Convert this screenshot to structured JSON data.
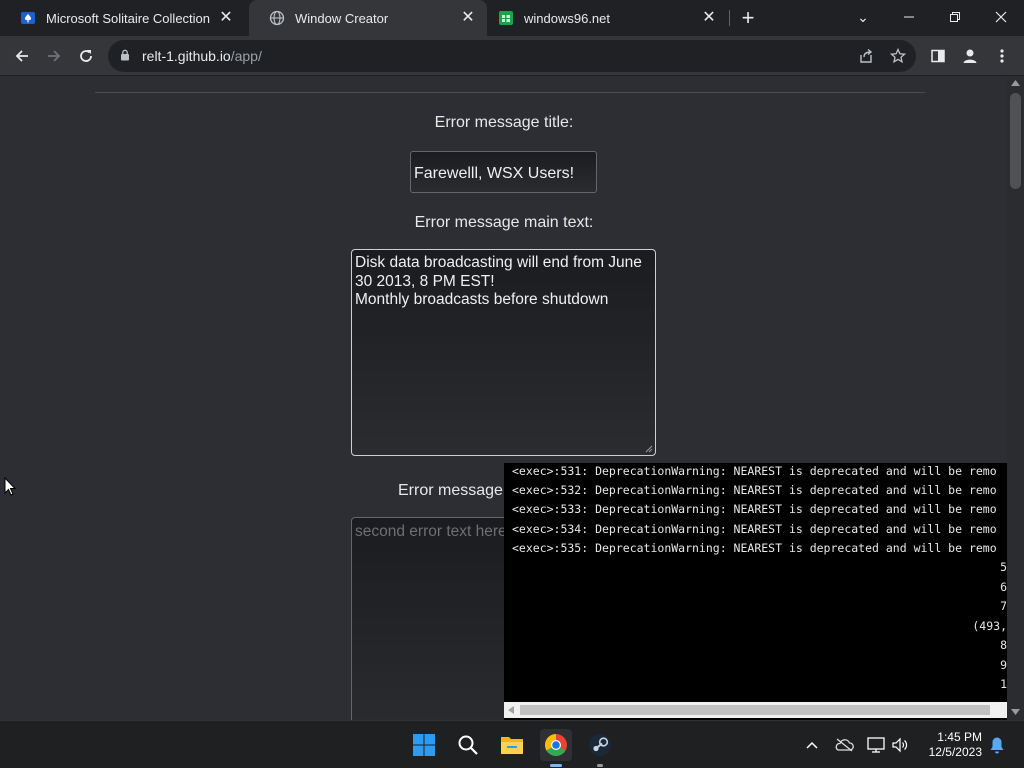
{
  "tabs": [
    {
      "title": "Microsoft Solitaire Collection",
      "active": false
    },
    {
      "title": "Window Creator",
      "active": true
    },
    {
      "title": "windows96.net",
      "active": false
    }
  ],
  "address": {
    "host": "relt-1.github.io",
    "path": "/app/"
  },
  "form": {
    "title_label": "Error message title:",
    "title_value": "Farewelll, WSX Users!",
    "main_label": "Error message main text:",
    "main_line1": "Disk data broadcasting will end from June",
    "main_line2": "30 2013, 8 PM EST!",
    "main_line3": "Monthly broadcasts before shutdown",
    "second_label": "Error message s",
    "second_placeholder": "second error text here"
  },
  "terminal": {
    "lines": [
      "<exec>:531: DeprecationWarning: NEAREST is deprecated and will be remo",
      "<exec>:532: DeprecationWarning: NEAREST is deprecated and will be remo",
      "<exec>:533: DeprecationWarning: NEAREST is deprecated and will be remo",
      "<exec>:534: DeprecationWarning: NEAREST is deprecated and will be remo",
      "<exec>:535: DeprecationWarning: NEAREST is deprecated and will be remo"
    ],
    "right_fragments": [
      "5",
      "6",
      "7",
      "(493,",
      "8",
      "9",
      "1"
    ]
  },
  "taskbar": {
    "time": "1:45 PM",
    "date": "12/5/2023"
  },
  "colors": {
    "accent_windows": "#2b9bf4",
    "chrome_red": "#ea4335",
    "chrome_yellow": "#fbbc04",
    "chrome_green": "#34a853"
  }
}
